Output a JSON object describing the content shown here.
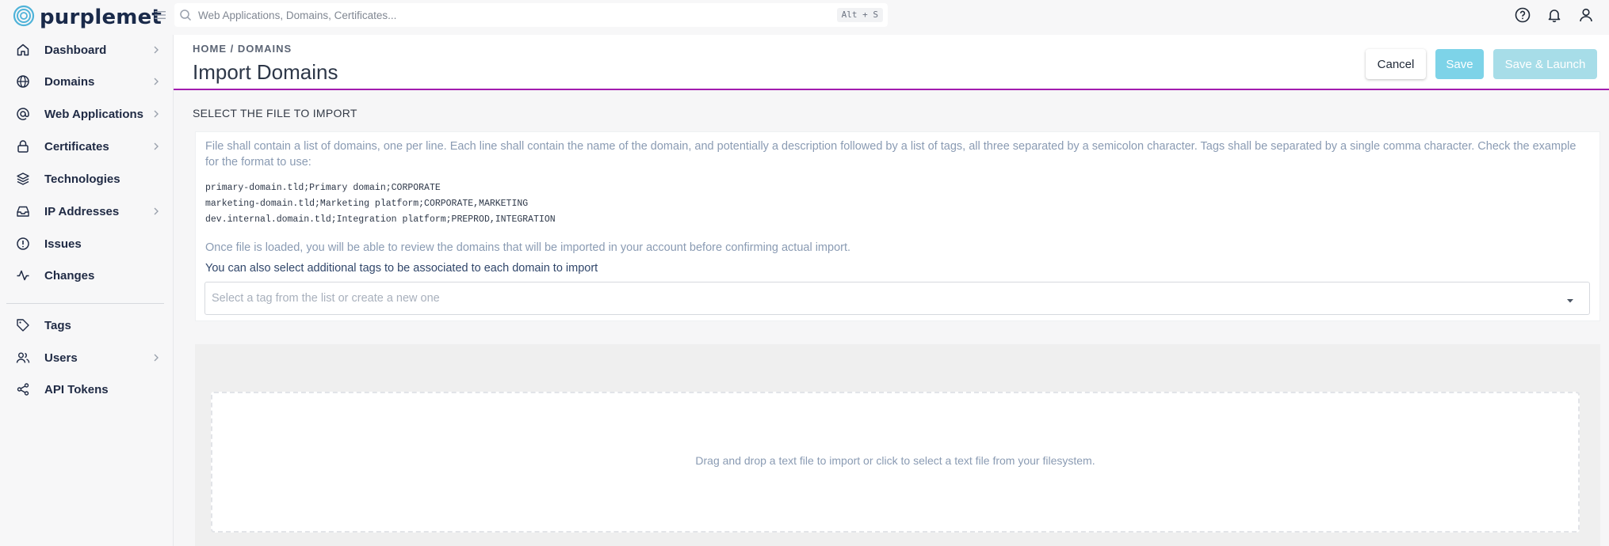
{
  "app": {
    "brand": "purplemet",
    "brand_color": "#1a2a4a",
    "accent_color": "#a21caf"
  },
  "search": {
    "placeholder": "Web Applications, Domains, Certificates...",
    "shortcut": "Alt + S",
    "icon": "search-icon"
  },
  "top_icons": [
    "help-icon",
    "bell-icon",
    "user-icon"
  ],
  "sidebar": {
    "items": [
      {
        "label": "Dashboard",
        "icon": "home-icon",
        "has_chevron": true
      },
      {
        "label": "Domains",
        "icon": "globe-icon",
        "has_chevron": true
      },
      {
        "label": "Web Applications",
        "icon": "at-icon",
        "has_chevron": true
      },
      {
        "label": "Certificates",
        "icon": "lock-icon",
        "has_chevron": true
      },
      {
        "label": "Technologies",
        "icon": "layers-icon",
        "has_chevron": false
      },
      {
        "label": "IP Addresses",
        "icon": "inbox-icon",
        "has_chevron": true
      },
      {
        "label": "Issues",
        "icon": "alert-circle-icon",
        "has_chevron": false
      },
      {
        "label": "Changes",
        "icon": "activity-icon",
        "has_chevron": false
      },
      {
        "label": "Tags",
        "icon": "tag-icon",
        "has_chevron": false
      },
      {
        "label": "Users",
        "icon": "users-icon",
        "has_chevron": true
      },
      {
        "label": "API Tokens",
        "icon": "share-icon",
        "has_chevron": false
      }
    ]
  },
  "header": {
    "breadcrumb": "HOME / DOMAINS",
    "title": "Import Domains",
    "cancel_label": "Cancel",
    "save_label": "Save",
    "save_launch_label": "Save & Launch"
  },
  "import": {
    "section_label": "SELECT THE FILE TO IMPORT",
    "instructions": "File shall contain a list of domains, one per line. Each line shall contain the name of the domain, and potentially a description followed by a list of tags, all three separated by a semicolon character. Tags shall be separated by a single comma character. Check the example for the format to use:",
    "example_lines": [
      "primary-domain.tld;Primary domain;CORPORATE",
      "marketing-domain.tld;Marketing platform;CORPORATE,MARKETING",
      "dev.internal.domain.tld;Integration platform;PREPROD,INTEGRATION"
    ],
    "review_note": "Once file is loaded, you will be able to review the domains that will be imported in your account before confirming actual import.",
    "tags_label": "You can also select additional tags to be associated to each domain to import",
    "tags_placeholder": "Select a tag from the list or create a new one",
    "dropzone_text": "Drag and drop a text file to import or click to select a text file from your filesystem."
  }
}
